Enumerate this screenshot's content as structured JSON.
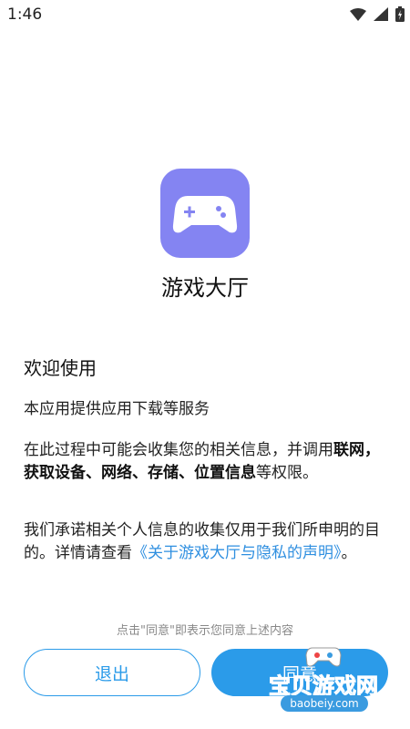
{
  "status_bar": {
    "time": "1:46"
  },
  "app": {
    "name": "游戏大厅"
  },
  "content": {
    "welcome": "欢迎使用",
    "p1": "本应用提供应用下载等服务",
    "p2_prefix": "在此过程中可能会收集您的相关信息，并调用",
    "p2_bold": "联网，获取设备、网络、存储、位置信息",
    "p2_suffix": "等权限。",
    "p3_text": "我们承诺相关个人信息的收集仅用于我们所申明的目的。详情请查看",
    "p3_link": "《关于游戏大厅与隐私的声明》",
    "p3_end": "。"
  },
  "hint": "点击\"同意\"即表示您同意上述内容",
  "buttons": {
    "exit": "退出",
    "agree": "同意"
  },
  "watermark": {
    "text": "宝贝游戏网",
    "url": "baobeiy.com"
  },
  "colors": {
    "accent": "#2b9be9",
    "icon_bg": "#8484f2",
    "link": "#2f8fe0"
  }
}
